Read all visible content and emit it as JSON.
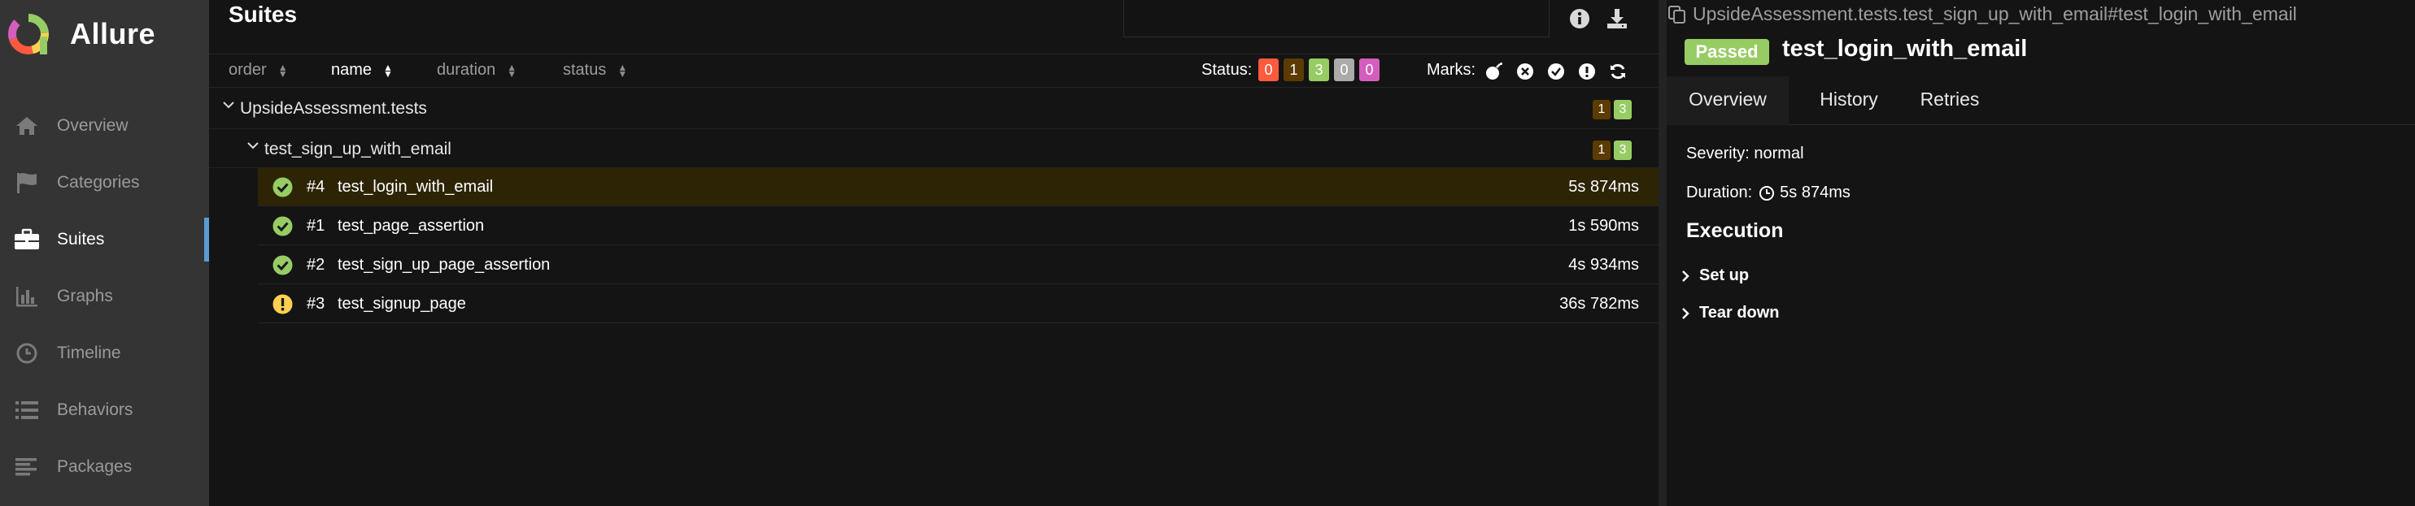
{
  "app": {
    "name": "Allure",
    "brand_colors": [
      "#97cc64",
      "#ffd050",
      "#fd5a3e",
      "#d35ebe",
      "#aaaaaa"
    ]
  },
  "sidebar": {
    "items": [
      {
        "label": "Overview",
        "icon": "home-icon",
        "active": false
      },
      {
        "label": "Categories",
        "icon": "flag-icon",
        "active": false
      },
      {
        "label": "Suites",
        "icon": "briefcase-icon",
        "active": true
      },
      {
        "label": "Graphs",
        "icon": "bar-chart-icon",
        "active": false
      },
      {
        "label": "Timeline",
        "icon": "clock-icon",
        "active": false
      },
      {
        "label": "Behaviors",
        "icon": "list-icon",
        "active": false
      },
      {
        "label": "Packages",
        "icon": "align-left-icon",
        "active": false
      }
    ]
  },
  "suites": {
    "title": "Suites",
    "sort": {
      "order": "order",
      "name": "name",
      "duration": "duration",
      "status": "status"
    },
    "status_filter": {
      "label": "Status:",
      "counts": [
        {
          "value": "0",
          "color": "#fd5a3e"
        },
        {
          "value": "1",
          "color": "#5c3b00"
        },
        {
          "value": "3",
          "color": "#97cc64"
        },
        {
          "value": "0",
          "color": "#aaaaaa"
        },
        {
          "value": "0",
          "color": "#d35ebe"
        }
      ]
    },
    "marks_label": "Marks:",
    "groups": [
      {
        "name": "UpsideAssessment.tests",
        "counts": [
          "1",
          "3"
        ]
      },
      {
        "name": "test_sign_up_with_email",
        "counts": [
          "1",
          "3"
        ]
      }
    ],
    "tests": [
      {
        "num": "#4",
        "name": "test_login_with_email",
        "duration": "5s 874ms",
        "status": "passed",
        "selected": true
      },
      {
        "num": "#1",
        "name": "test_page_assertion",
        "duration": "1s 590ms",
        "status": "passed",
        "selected": false
      },
      {
        "num": "#2",
        "name": "test_sign_up_page_assertion",
        "duration": "4s 934ms",
        "status": "passed",
        "selected": false
      },
      {
        "num": "#3",
        "name": "test_signup_page",
        "duration": "36s 782ms",
        "status": "broken",
        "selected": false
      }
    ]
  },
  "detail": {
    "path": "UpsideAssessment.tests.test_sign_up_with_email#test_login_with_email",
    "status_badge": "Passed",
    "title": "test_login_with_email",
    "tabs": [
      "Overview",
      "History",
      "Retries"
    ],
    "severity_label": "Severity:",
    "severity_value": "normal",
    "duration_label": "Duration:",
    "duration_value": "5s 874ms",
    "execution_title": "Execution",
    "steps": [
      "Set up",
      "Tear down"
    ]
  }
}
